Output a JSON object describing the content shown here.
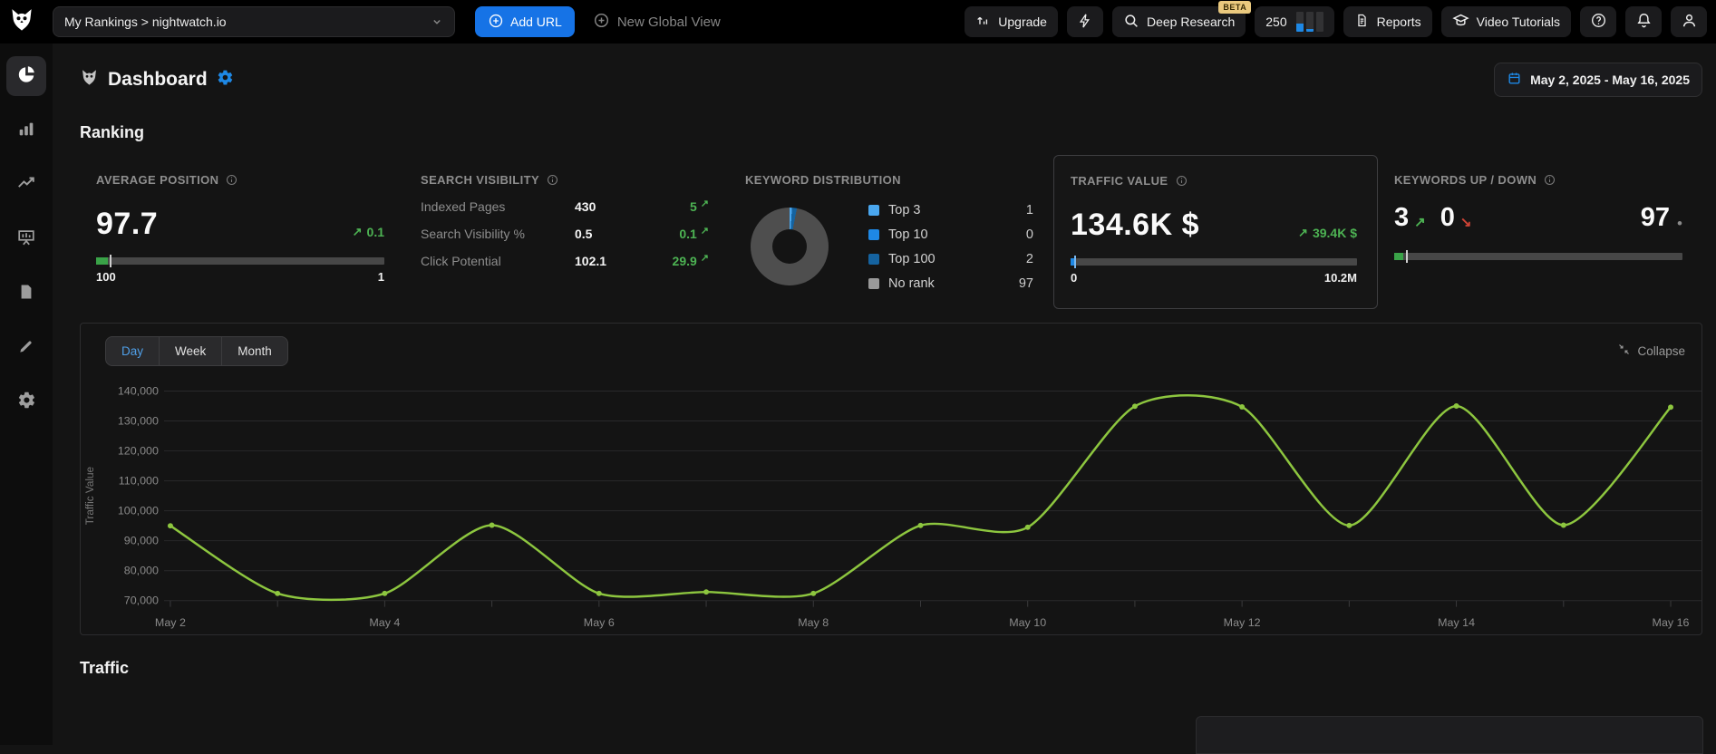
{
  "topbar": {
    "project_selector": "My Rankings > nightwatch.io",
    "add_url": "Add URL",
    "new_global_view": "New Global View",
    "upgrade": "Upgrade",
    "deep_research": "Deep Research",
    "beta": "BETA",
    "credits": "250",
    "reports": "Reports",
    "video_tutorials": "Video Tutorials"
  },
  "header": {
    "title": "Dashboard",
    "date_range": "May 2, 2025 - May 16, 2025"
  },
  "sections": {
    "ranking": "Ranking",
    "traffic": "Traffic"
  },
  "icons": {
    "up_arrow": "↗",
    "down_arrow": "↘",
    "dot": "•"
  },
  "cards": {
    "average_position": {
      "label": "AVERAGE POSITION",
      "value": "97.7",
      "delta": "0.1",
      "scale_left": "100",
      "scale_right": "1"
    },
    "search_visibility": {
      "label": "SEARCH VISIBILITY",
      "rows": [
        {
          "label": "Indexed Pages",
          "value": "430",
          "delta": "5"
        },
        {
          "label": "Search Visibility %",
          "value": "0.5",
          "delta": "0.1"
        },
        {
          "label": "Click Potential",
          "value": "102.1",
          "delta": "29.9"
        }
      ]
    },
    "keyword_distribution": {
      "label": "KEYWORD DISTRIBUTION",
      "legend": [
        {
          "label": "Top 3",
          "value": "1",
          "color": "#4aa7ef",
          "donut_color": "#4aa7ef"
        },
        {
          "label": "Top 10",
          "value": "0",
          "color": "#1e88e5",
          "donut_color": "#1e88e5"
        },
        {
          "label": "Top 100",
          "value": "2",
          "color": "#1563a0",
          "donut_color": "#1563a0"
        },
        {
          "label": "No rank",
          "value": "97",
          "color": "#9a9a9a",
          "donut_color": "#4e4e4e"
        }
      ]
    },
    "traffic_value": {
      "label": "TRAFFIC VALUE",
      "value": "134.6K $",
      "delta": "39.4K $",
      "scale_left": "0",
      "scale_right": "10.2M"
    },
    "keywords_up_down": {
      "label": "KEYWORDS UP / DOWN",
      "up": "3",
      "down": "0",
      "no_change": "97"
    }
  },
  "chart_panel": {
    "tabs": [
      "Day",
      "Week",
      "Month"
    ],
    "active_tab": "Day",
    "collapse": "Collapse"
  },
  "chart_data": {
    "type": "line",
    "title": "",
    "x": [
      "May 2",
      "May 3",
      "May 4",
      "May 5",
      "May 6",
      "May 7",
      "May 8",
      "May 9",
      "May 10",
      "May 11",
      "May 12",
      "May 13",
      "May 14",
      "May 15",
      "May 16"
    ],
    "series": [
      {
        "name": "Traffic Value",
        "color": "#8dc63f",
        "values": [
          95000,
          72400,
          72400,
          95200,
          72400,
          72900,
          72400,
          95100,
          94500,
          134900,
          134700,
          95100,
          135000,
          95200,
          134600
        ]
      }
    ],
    "xlabel": "",
    "ylabel": "Traffic Value",
    "ylim": [
      70000,
      140000
    ],
    "ytick_step": 10000,
    "x_labeled_every": 2,
    "grid": true,
    "legend": "none",
    "smooth": true,
    "markers": true
  },
  "colors": {
    "accent_blue": "#1673e6",
    "delta_green": "#4db353",
    "delta_red": "#cf4436",
    "line_green": "#8dc63f"
  }
}
